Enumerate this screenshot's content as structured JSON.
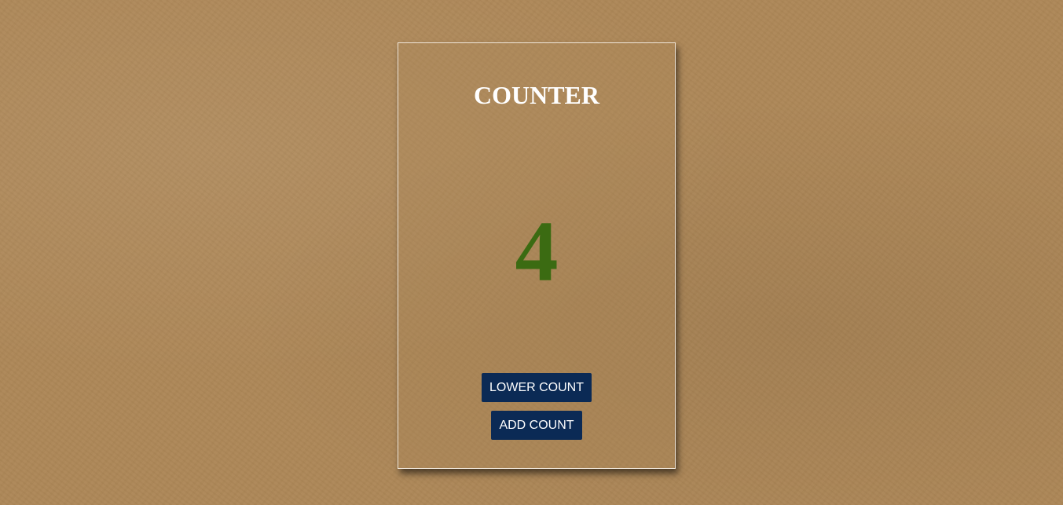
{
  "counter": {
    "title": "COUNTER",
    "value": "4",
    "value_color": "#3b6b12"
  },
  "buttons": {
    "lower_label": "LOWER COUNT",
    "add_label": "ADD COUNT",
    "color": "#0b2a55"
  }
}
